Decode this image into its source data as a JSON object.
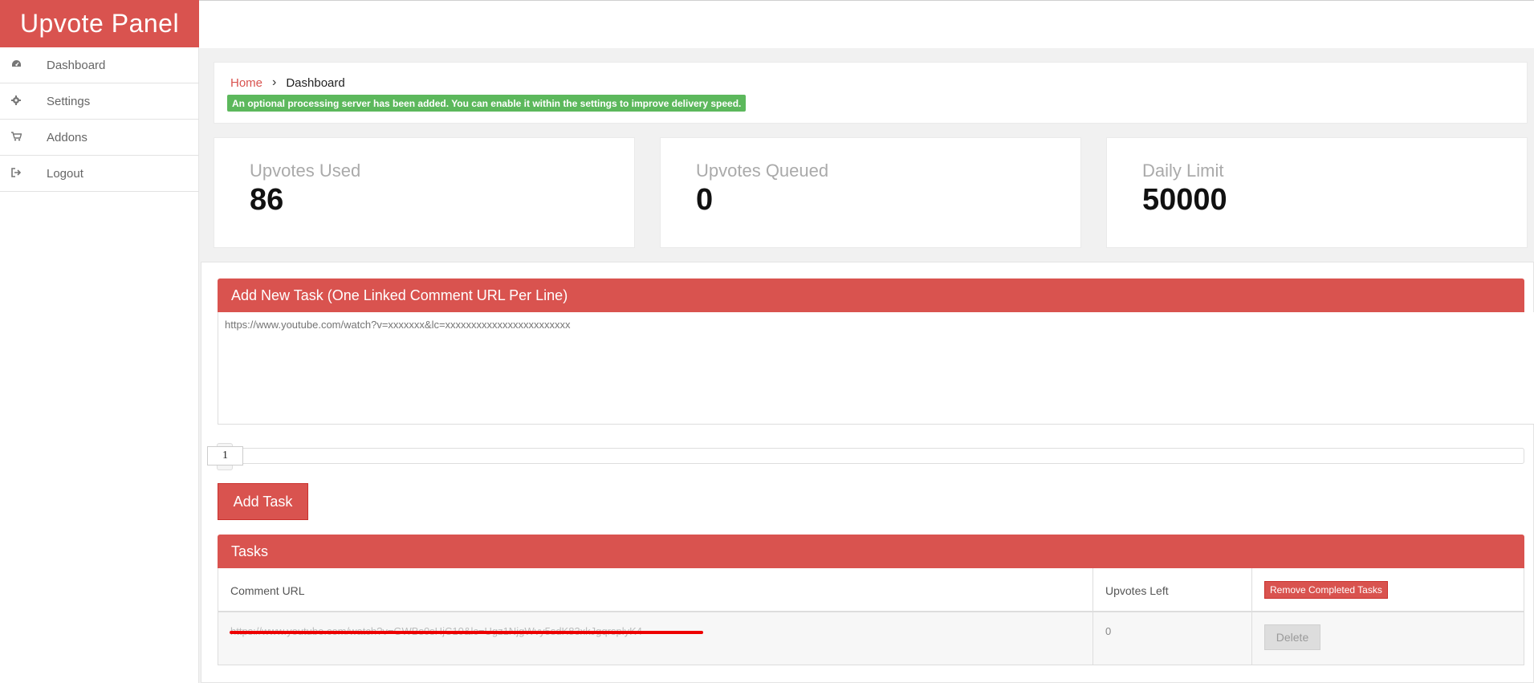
{
  "app": {
    "brand": "Upvote Panel"
  },
  "sidebar": {
    "items": [
      {
        "label": "Dashboard",
        "icon": "dashboard-icon"
      },
      {
        "label": "Settings",
        "icon": "gear-icon"
      },
      {
        "label": "Addons",
        "icon": "cart-icon"
      },
      {
        "label": "Logout",
        "icon": "logout-icon"
      }
    ]
  },
  "breadcrumb": {
    "home": "Home",
    "separator": "›",
    "current": "Dashboard"
  },
  "alert": {
    "text": "An optional processing server has been added. You can enable it within the settings to improve delivery speed."
  },
  "stats": [
    {
      "label": "Upvotes Used",
      "value": "86"
    },
    {
      "label": "Upvotes Queued",
      "value": "0"
    },
    {
      "label": "Daily Limit",
      "value": "50000"
    }
  ],
  "add_task": {
    "title": "Add New Task (One Linked Comment URL Per Line)",
    "placeholder": "https://www.youtube.com/watch?v=xxxxxxx&lc=xxxxxxxxxxxxxxxxxxxxxxxx",
    "quantity": "1",
    "button_label": "Add Task"
  },
  "tasks": {
    "title": "Tasks",
    "columns": {
      "url": "Comment URL",
      "left": "Upvotes Left"
    },
    "remove_completed_label": "Remove Completed Tasks",
    "rows": [
      {
        "url": "https://www.youtube.com/watch?v=GWBs0sHjC10&lc=Ugz1NjgWvy5sdK83xkJgqrsplyK4",
        "left": "0",
        "action": "Delete"
      }
    ]
  },
  "colors": {
    "accent": "#d9534f",
    "success": "#5cb85c"
  }
}
